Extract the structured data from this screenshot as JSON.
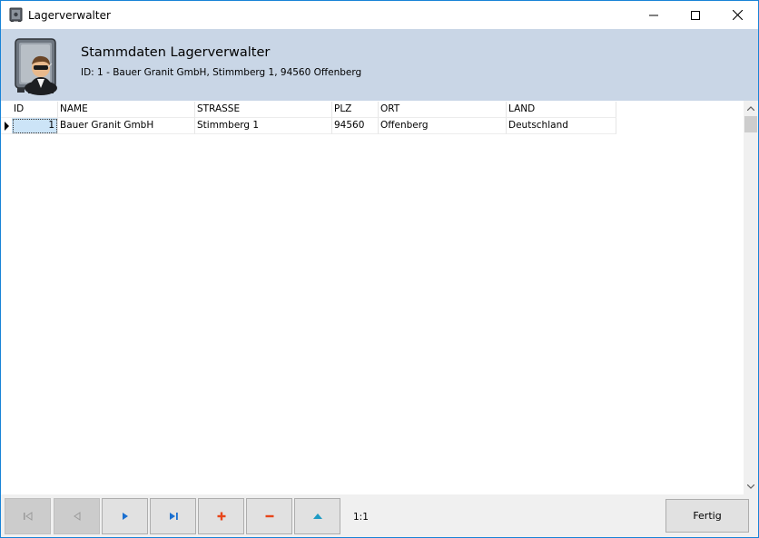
{
  "window": {
    "title": "Lagerverwalter",
    "icon": "safe-icon",
    "controls": [
      "minimize-icon",
      "maximize-icon",
      "close-icon"
    ]
  },
  "header": {
    "title": "Stammdaten Lagerverwalter",
    "subtitle": "ID: 1 - Bauer Granit GmbH, Stimmberg 1, 94560 Offenberg",
    "icon": "safe-manager-icon"
  },
  "grid": {
    "columns": [
      "ID",
      "NAME",
      "STRASSE",
      "PLZ",
      "ORT",
      "LAND"
    ],
    "rows": [
      {
        "id": "1",
        "name": "Bauer Granit GmbH",
        "strasse": "Stimmberg 1",
        "plz": "94560",
        "ort": "Offenberg",
        "land": "Deutschland"
      }
    ],
    "current_row_indicator": "row-pointer-icon"
  },
  "toolbar": {
    "buttons": [
      {
        "name": "first-record-button",
        "icon": "first-record-icon",
        "enabled": false
      },
      {
        "name": "prior-record-button",
        "icon": "prior-record-icon",
        "enabled": false
      },
      {
        "name": "next-record-button",
        "icon": "next-record-icon",
        "enabled": true
      },
      {
        "name": "last-record-button",
        "icon": "last-record-icon",
        "enabled": true
      },
      {
        "name": "insert-record-button",
        "icon": "plus-icon",
        "enabled": true
      },
      {
        "name": "delete-record-button",
        "icon": "minus-icon",
        "enabled": true
      },
      {
        "name": "post-record-button",
        "icon": "caret-up-icon",
        "enabled": true
      }
    ],
    "record_position": "1:1",
    "done_label": "Fertig"
  },
  "colors": {
    "header_band": "#c9d6e6",
    "window_border": "#1883d7",
    "nav_arrow_blue": "#1a6fd0",
    "plus_minus_red": "#e8461b",
    "post_teal": "#1e9bc4"
  }
}
